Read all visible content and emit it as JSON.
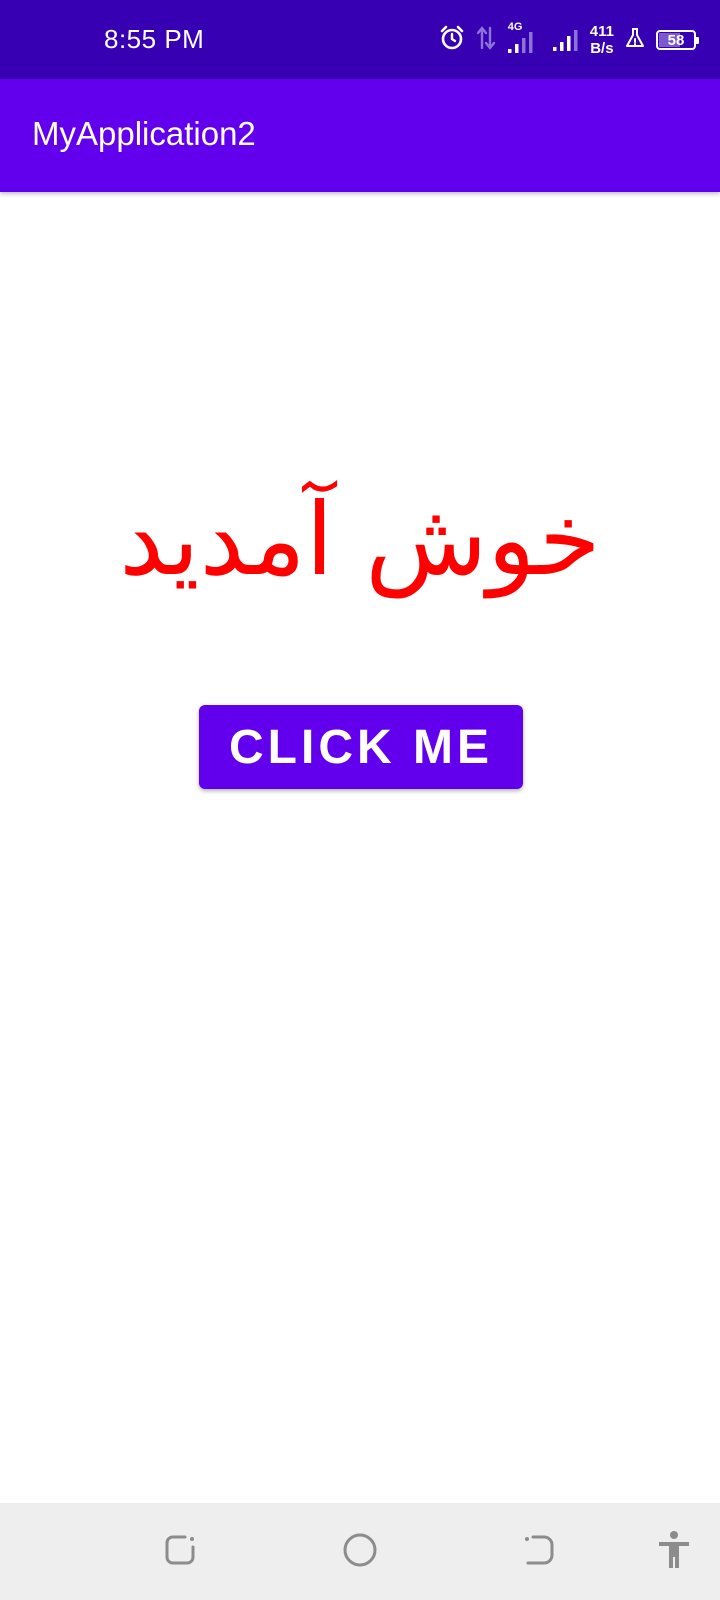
{
  "status_bar": {
    "time": "8:55 PM",
    "network_type": "4G",
    "net_speed_value": "411",
    "net_speed_unit": "B/s",
    "battery": "58",
    "battery_level": 0.58,
    "icons": [
      "alarm-icon",
      "data-transfer-icon",
      "signal-strength-icon",
      "signal-strength-icon",
      "lab-flask-icon",
      "battery-icon"
    ]
  },
  "app_bar": {
    "title": "MyApplication2"
  },
  "main": {
    "welcome_text": "خوش آمدید",
    "button_label": "CLICK ME"
  },
  "nav_bar": {
    "icons": [
      "recents-icon",
      "home-icon",
      "back-icon",
      "accessibility-icon"
    ]
  },
  "colors": {
    "status_bar": "#3700b3",
    "primary": "#6200ee",
    "welcome_text": "#ff0000",
    "nav_bar": "#eeeeee"
  }
}
